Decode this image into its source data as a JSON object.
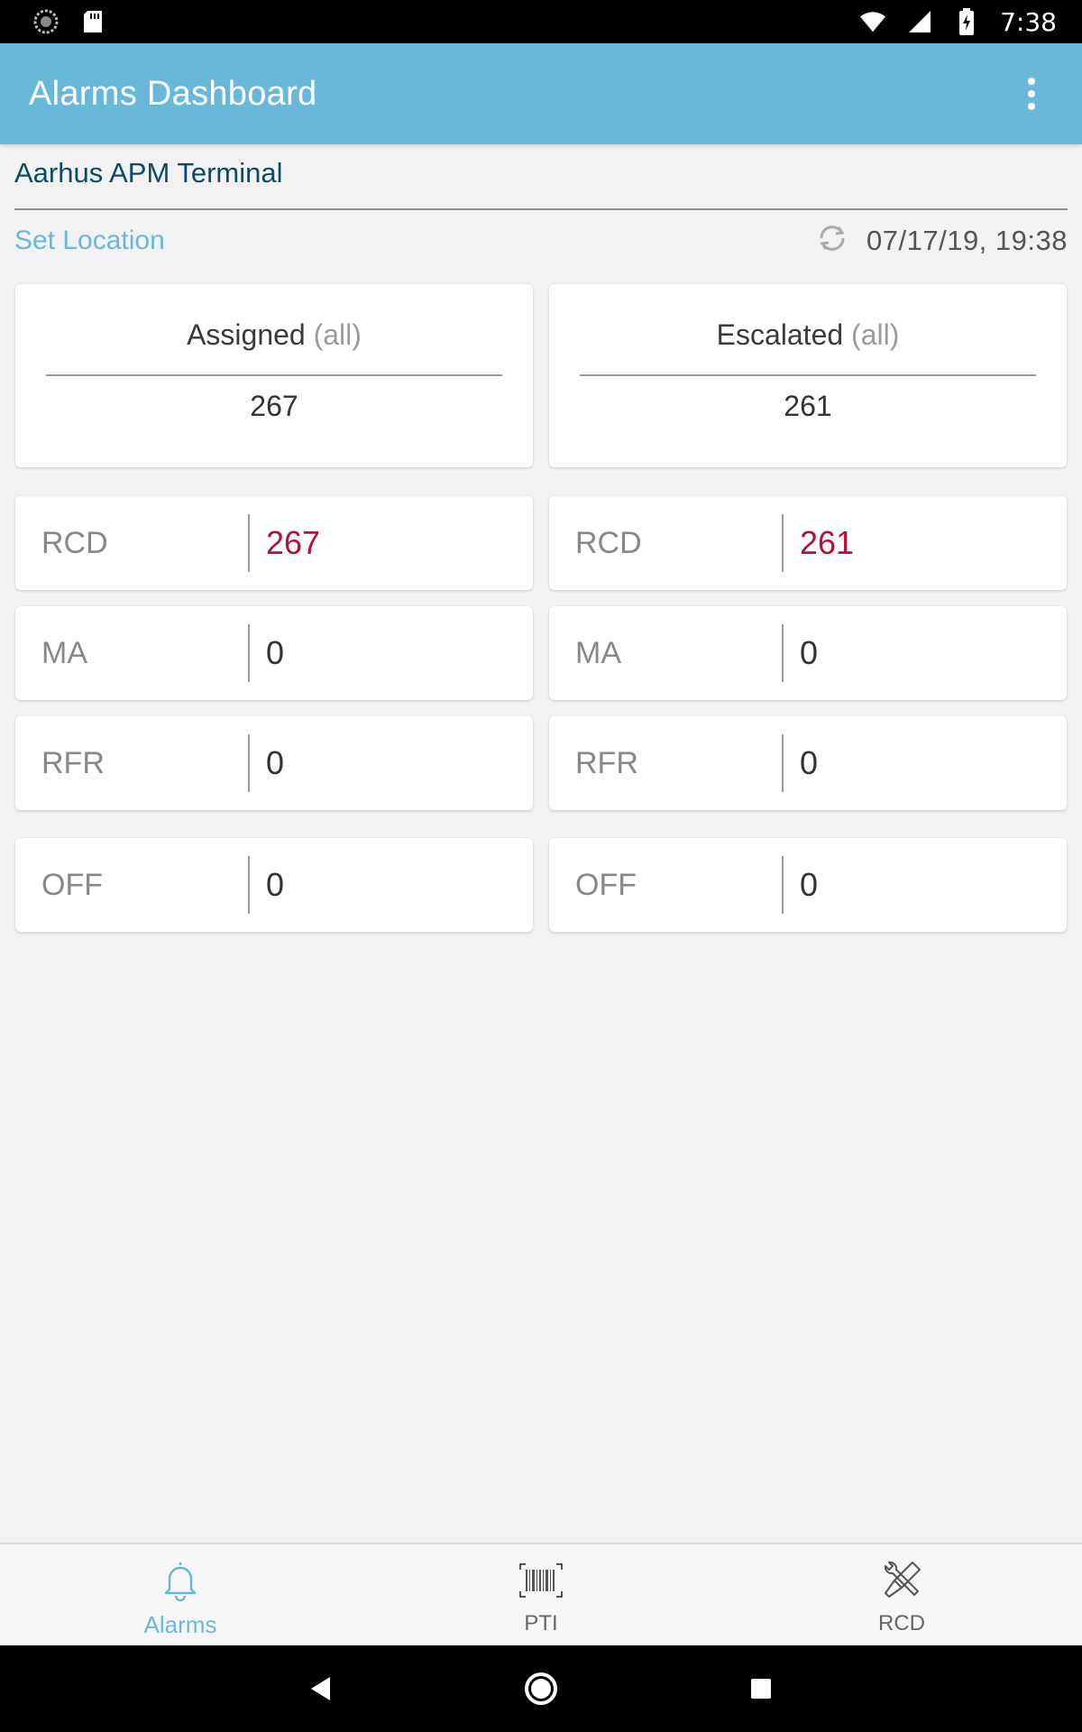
{
  "status_bar": {
    "time": "7:38",
    "icons": [
      "sync-indicator-icon",
      "sd-card-icon",
      "wifi-icon",
      "signal-icon",
      "battery-charging-icon"
    ]
  },
  "app_bar": {
    "title": "Alarms Dashboard",
    "menu_icon": "overflow-menu-icon"
  },
  "location": {
    "terminal_name": "Aarhus APM Terminal",
    "set_location_label": "Set Location",
    "refresh_icon": "refresh-icon",
    "timestamp": "07/17/19, 19:38"
  },
  "columns": [
    {
      "title": "Assigned",
      "qualifier": "(all)",
      "total": "267",
      "rows": [
        {
          "label": "RCD",
          "value": "267",
          "alert": true
        },
        {
          "label": "MA",
          "value": "0",
          "alert": false
        },
        {
          "label": "RFR",
          "value": "0",
          "alert": false
        },
        {
          "label": "OFF",
          "value": "0",
          "alert": false
        }
      ]
    },
    {
      "title": "Escalated",
      "qualifier": "(all)",
      "total": "261",
      "rows": [
        {
          "label": "RCD",
          "value": "261",
          "alert": true
        },
        {
          "label": "MA",
          "value": "0",
          "alert": false
        },
        {
          "label": "RFR",
          "value": "0",
          "alert": false
        },
        {
          "label": "OFF",
          "value": "0",
          "alert": false
        }
      ]
    }
  ],
  "bottom_nav": {
    "items": [
      {
        "label": "Alarms",
        "icon": "bell-icon",
        "active": true
      },
      {
        "label": "PTI",
        "icon": "barcode-icon",
        "active": false
      },
      {
        "label": "RCD",
        "icon": "tools-icon",
        "active": false
      }
    ]
  },
  "colors": {
    "accent": "#6ab8d9",
    "alert_value": "#b5103a",
    "terminal_name": "#0d4a66"
  }
}
